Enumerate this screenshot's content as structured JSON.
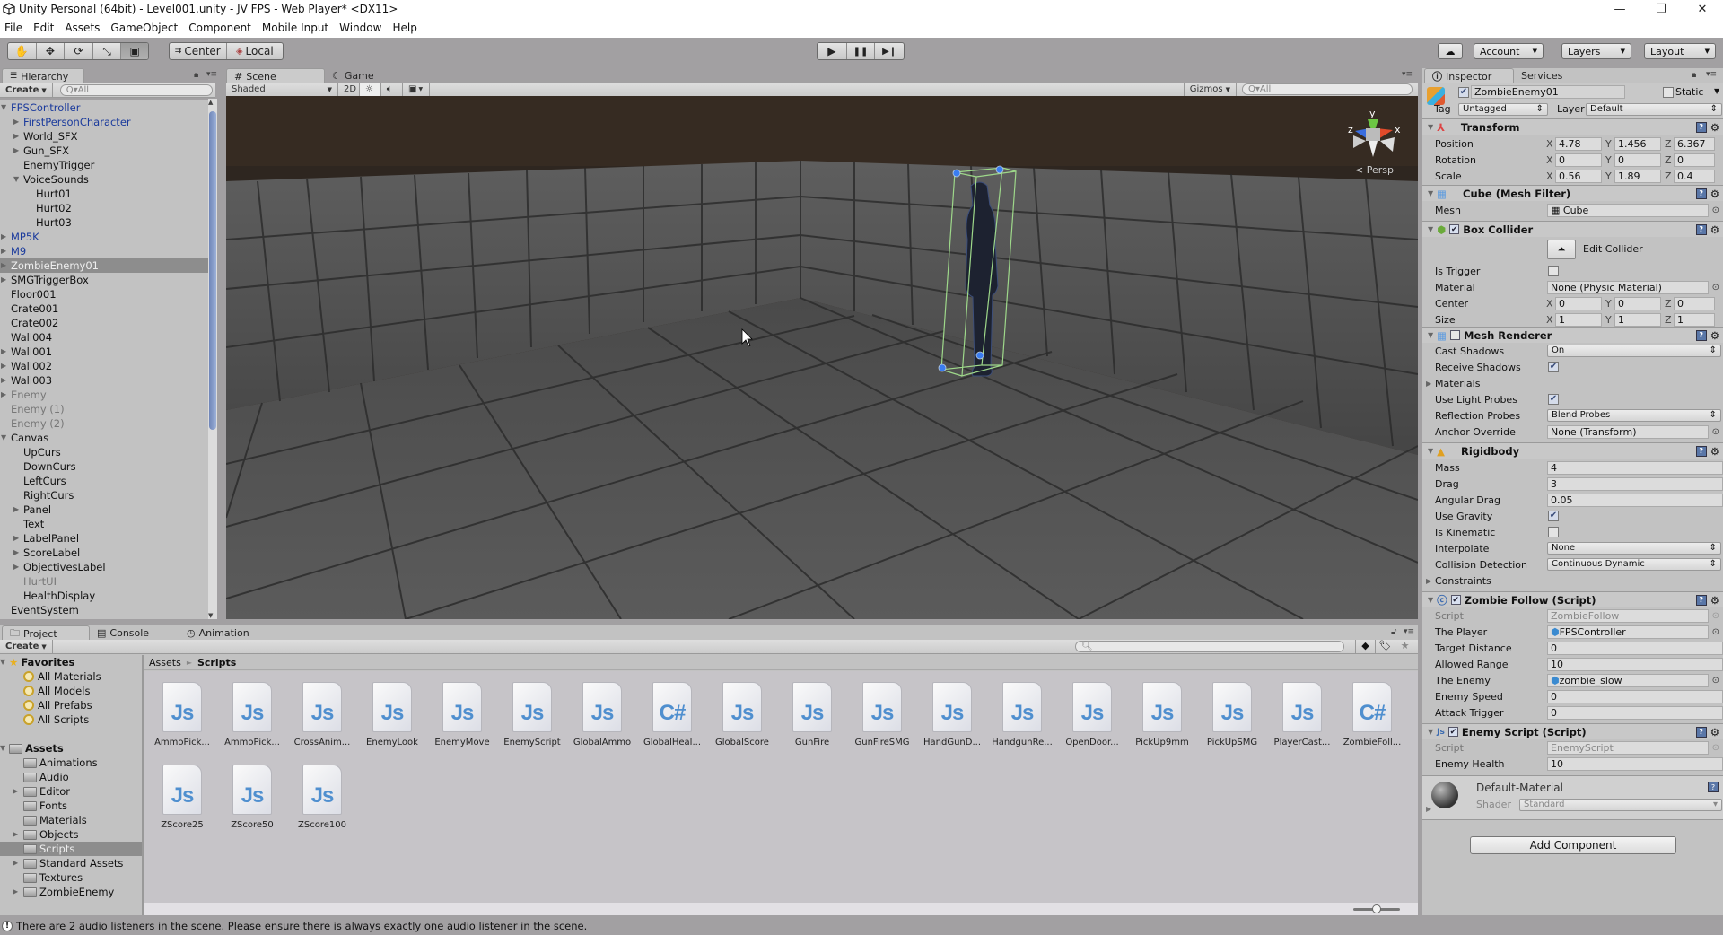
{
  "window": {
    "title": "Unity Personal (64bit) - Level001.unity - JV FPS - Web Player* <DX11>",
    "minimize": "—",
    "maximize": "❐",
    "close": "✕"
  },
  "menu": [
    "File",
    "Edit",
    "Assets",
    "GameObject",
    "Component",
    "Mobile Input",
    "Window",
    "Help"
  ],
  "toolbar": {
    "tools": [
      "hand-icon",
      "move-icon",
      "rotate-icon",
      "scale-icon",
      "rect-icon"
    ],
    "tool_glyphs": [
      "✋",
      "✥",
      "⟳",
      "⤡",
      "▣"
    ],
    "pivot": "Center",
    "space": "Local",
    "play": "▶",
    "pause": "❚❚",
    "step": "▶❙",
    "cloud": "☁",
    "account": "Account",
    "layers": "Layers",
    "layout": "Layout"
  },
  "hierarchy": {
    "tab": "Hierarchy",
    "create": "Create",
    "search_placeholder": "Q▾All",
    "items": [
      {
        "label": "FPSController",
        "depth": 0,
        "arrow": "down",
        "style": "blue"
      },
      {
        "label": "FirstPersonCharacter",
        "depth": 1,
        "arrow": "right",
        "style": "blue"
      },
      {
        "label": "World_SFX",
        "depth": 1,
        "arrow": "right",
        "style": ""
      },
      {
        "label": "Gun_SFX",
        "depth": 1,
        "arrow": "right",
        "style": ""
      },
      {
        "label": "EnemyTrigger",
        "depth": 1,
        "arrow": "",
        "style": ""
      },
      {
        "label": "VoiceSounds",
        "depth": 1,
        "arrow": "down",
        "style": ""
      },
      {
        "label": "Hurt01",
        "depth": 2,
        "arrow": "",
        "style": ""
      },
      {
        "label": "Hurt02",
        "depth": 2,
        "arrow": "",
        "style": ""
      },
      {
        "label": "Hurt03",
        "depth": 2,
        "arrow": "",
        "style": ""
      },
      {
        "label": "MP5K",
        "depth": 0,
        "arrow": "right",
        "style": "blue"
      },
      {
        "label": "M9",
        "depth": 0,
        "arrow": "right",
        "style": "blue"
      },
      {
        "label": "ZombieEnemy01",
        "depth": 0,
        "arrow": "right",
        "style": "sel"
      },
      {
        "label": "SMGTriggerBox",
        "depth": 0,
        "arrow": "right",
        "style": ""
      },
      {
        "label": "Floor001",
        "depth": 0,
        "arrow": "",
        "style": ""
      },
      {
        "label": "Crate001",
        "depth": 0,
        "arrow": "",
        "style": ""
      },
      {
        "label": "Crate002",
        "depth": 0,
        "arrow": "",
        "style": ""
      },
      {
        "label": "Wall004",
        "depth": 0,
        "arrow": "",
        "style": ""
      },
      {
        "label": "Wall001",
        "depth": 0,
        "arrow": "right",
        "style": ""
      },
      {
        "label": "Wall002",
        "depth": 0,
        "arrow": "right",
        "style": ""
      },
      {
        "label": "Wall003",
        "depth": 0,
        "arrow": "right",
        "style": ""
      },
      {
        "label": "Enemy",
        "depth": 0,
        "arrow": "right",
        "style": "dim"
      },
      {
        "label": "Enemy (1)",
        "depth": 0,
        "arrow": "",
        "style": "dim"
      },
      {
        "label": "Enemy (2)",
        "depth": 0,
        "arrow": "",
        "style": "dim"
      },
      {
        "label": "Canvas",
        "depth": 0,
        "arrow": "down",
        "style": ""
      },
      {
        "label": "UpCurs",
        "depth": 1,
        "arrow": "",
        "style": ""
      },
      {
        "label": "DownCurs",
        "depth": 1,
        "arrow": "",
        "style": ""
      },
      {
        "label": "LeftCurs",
        "depth": 1,
        "arrow": "",
        "style": ""
      },
      {
        "label": "RightCurs",
        "depth": 1,
        "arrow": "",
        "style": ""
      },
      {
        "label": "Panel",
        "depth": 1,
        "arrow": "right",
        "style": ""
      },
      {
        "label": "Text",
        "depth": 1,
        "arrow": "",
        "style": ""
      },
      {
        "label": "LabelPanel",
        "depth": 1,
        "arrow": "right",
        "style": ""
      },
      {
        "label": "ScoreLabel",
        "depth": 1,
        "arrow": "right",
        "style": ""
      },
      {
        "label": "ObjectivesLabel",
        "depth": 1,
        "arrow": "right",
        "style": ""
      },
      {
        "label": "HurtUI",
        "depth": 1,
        "arrow": "",
        "style": "dim"
      },
      {
        "label": "HealthDisplay",
        "depth": 1,
        "arrow": "",
        "style": ""
      },
      {
        "label": "EventSystem",
        "depth": 0,
        "arrow": "",
        "style": ""
      }
    ]
  },
  "scene": {
    "tabs": [
      "Scene",
      "Game"
    ],
    "shading": "Shaded",
    "mode_2d": "2D",
    "gizmos": "Gizmos",
    "search_placeholder": "Q▾All",
    "persp_label": "< Persp",
    "axis_labels": {
      "x": "x",
      "y": "y",
      "z": "z"
    }
  },
  "inspector": {
    "tabs": [
      "Inspector",
      "Services"
    ],
    "object_name": "ZombieEnemy01",
    "active": true,
    "static_label": "Static",
    "tag_label": "Tag",
    "tag_value": "Untagged",
    "layer_label": "Layer",
    "layer_value": "Default",
    "transform": {
      "title": "Transform",
      "position": {
        "label": "Position",
        "x": "4.78",
        "y": "1.456",
        "z": "6.367"
      },
      "rotation": {
        "label": "Rotation",
        "x": "0",
        "y": "0",
        "z": "0"
      },
      "scale": {
        "label": "Scale",
        "x": "0.56",
        "y": "1.89",
        "z": "0.4"
      }
    },
    "mesh_filter": {
      "title": "Cube (Mesh Filter)",
      "mesh_label": "Mesh",
      "mesh_value": "Cube"
    },
    "box_collider": {
      "title": "Box Collider",
      "enabled": true,
      "edit_collider": "Edit Collider",
      "is_trigger_label": "Is Trigger",
      "is_trigger": false,
      "material_label": "Material",
      "material_value": "None (Physic Material)",
      "center": {
        "label": "Center",
        "x": "0",
        "y": "0",
        "z": "0"
      },
      "size": {
        "label": "Size",
        "x": "1",
        "y": "1",
        "z": "1"
      }
    },
    "mesh_renderer": {
      "title": "Mesh Renderer",
      "enabled": false,
      "cast_shadows_label": "Cast Shadows",
      "cast_shadows": "On",
      "receive_shadows_label": "Receive Shadows",
      "receive_shadows": true,
      "materials_label": "Materials",
      "light_probes_label": "Use Light Probes",
      "light_probes": true,
      "reflection_label": "Reflection Probes",
      "reflection": "Blend Probes",
      "anchor_label": "Anchor Override",
      "anchor": "None (Transform)"
    },
    "rigidbody": {
      "title": "Rigidbody",
      "mass_label": "Mass",
      "mass": "4",
      "drag_label": "Drag",
      "drag": "3",
      "ang_drag_label": "Angular Drag",
      "ang_drag": "0.05",
      "gravity_label": "Use Gravity",
      "gravity": true,
      "kinematic_label": "Is Kinematic",
      "kinematic": false,
      "interp_label": "Interpolate",
      "interp": "None",
      "collision_label": "Collision Detection",
      "collision": "Continuous Dynamic",
      "constraints_label": "Constraints"
    },
    "zombie_follow": {
      "title": "Zombie Follow (Script)",
      "enabled": true,
      "script_label": "Script",
      "script": "ZombieFollow",
      "player_label": "The Player",
      "player": "FPSController",
      "target_label": "Target Distance",
      "target": "0",
      "range_label": "Allowed Range",
      "range": "10",
      "enemy_label": "The Enemy",
      "enemy": "zombie_slow",
      "speed_label": "Enemy Speed",
      "speed": "0",
      "attack_label": "Attack Trigger",
      "attack": "0"
    },
    "enemy_script": {
      "title": "Enemy Script (Script)",
      "enabled": true,
      "script_label": "Script",
      "script": "EnemyScript",
      "health_label": "Enemy Health",
      "health": "10"
    },
    "material": {
      "name": "Default-Material",
      "shader_label": "Shader",
      "shader": "Standard"
    },
    "add_component": "Add Component"
  },
  "project": {
    "tabs": [
      "Project",
      "Console",
      "Animation"
    ],
    "create": "Create",
    "favorites_label": "Favorites",
    "favorites": [
      "All Materials",
      "All Models",
      "All Prefabs",
      "All Scripts"
    ],
    "assets_label": "Assets",
    "folders": [
      {
        "label": "Animations",
        "arrow": false
      },
      {
        "label": "Audio",
        "arrow": false
      },
      {
        "label": "Editor",
        "arrow": true
      },
      {
        "label": "Fonts",
        "arrow": false
      },
      {
        "label": "Materials",
        "arrow": false
      },
      {
        "label": "Objects",
        "arrow": true
      },
      {
        "label": "Scripts",
        "arrow": false,
        "selected": true
      },
      {
        "label": "Standard Assets",
        "arrow": true
      },
      {
        "label": "Textures",
        "arrow": false
      },
      {
        "label": "ZombieEnemy",
        "arrow": true
      }
    ],
    "breadcrumb": [
      "Assets",
      "Scripts"
    ],
    "breadcrumb_sep": "►",
    "files": [
      {
        "name": "AmmoPick...",
        "type": "Js"
      },
      {
        "name": "AmmoPick...",
        "type": "Js"
      },
      {
        "name": "CrossAnim...",
        "type": "Js"
      },
      {
        "name": "EnemyLook",
        "type": "Js"
      },
      {
        "name": "EnemyMove",
        "type": "Js"
      },
      {
        "name": "EnemyScript",
        "type": "Js"
      },
      {
        "name": "GlobalAmmo",
        "type": "Js"
      },
      {
        "name": "GlobalHeal...",
        "type": "C#"
      },
      {
        "name": "GlobalScore",
        "type": "Js"
      },
      {
        "name": "GunFire",
        "type": "Js"
      },
      {
        "name": "GunFireSMG",
        "type": "Js"
      },
      {
        "name": "HandGunD...",
        "type": "Js"
      },
      {
        "name": "HandgunRe...",
        "type": "Js"
      },
      {
        "name": "OpenDoor...",
        "type": "Js"
      },
      {
        "name": "PickUp9mm",
        "type": "Js"
      },
      {
        "name": "PickUpSMG",
        "type": "Js"
      },
      {
        "name": "PlayerCast...",
        "type": "Js"
      },
      {
        "name": "ZombieFoll...",
        "type": "C#"
      },
      {
        "name": "ZScore25",
        "type": "Js"
      },
      {
        "name": "ZScore50",
        "type": "Js"
      },
      {
        "name": "ZScore100",
        "type": "Js"
      }
    ],
    "icon_size_slider": 0.5
  },
  "status": {
    "message": "There are 2 audio listeners in the scene. Please ensure there is always exactly one audio listener in the scene."
  }
}
